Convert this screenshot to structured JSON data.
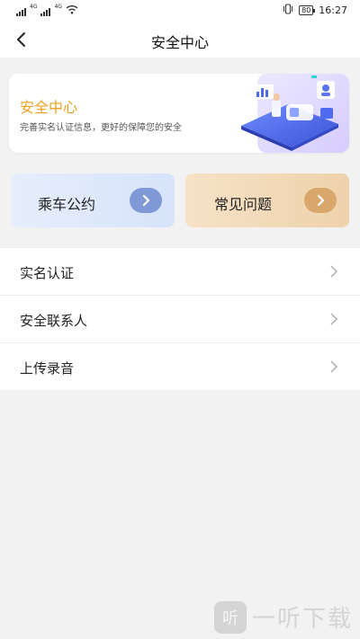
{
  "status_bar": {
    "network_a": "4G",
    "network_b": "4G",
    "battery": "80",
    "time": "16:27"
  },
  "header": {
    "title": "安全中心"
  },
  "banner": {
    "title": "安全中心",
    "subtitle": "完善实名认证信息，更好的保障您的安全"
  },
  "shortcuts": [
    {
      "label": "乘车公约",
      "icon": "chevron-right-icon",
      "color": "#7f99d6"
    },
    {
      "label": "常见问题",
      "icon": "chevron-right-icon",
      "color": "#d9a76b"
    }
  ],
  "menu": {
    "items": [
      {
        "label": "实名认证"
      },
      {
        "label": "安全联系人"
      },
      {
        "label": "上传录音"
      }
    ]
  },
  "watermark": {
    "logo_char": "听",
    "text": "一听下载"
  },
  "colors": {
    "accent": "#f0a020",
    "background": "#f2f2f2"
  }
}
